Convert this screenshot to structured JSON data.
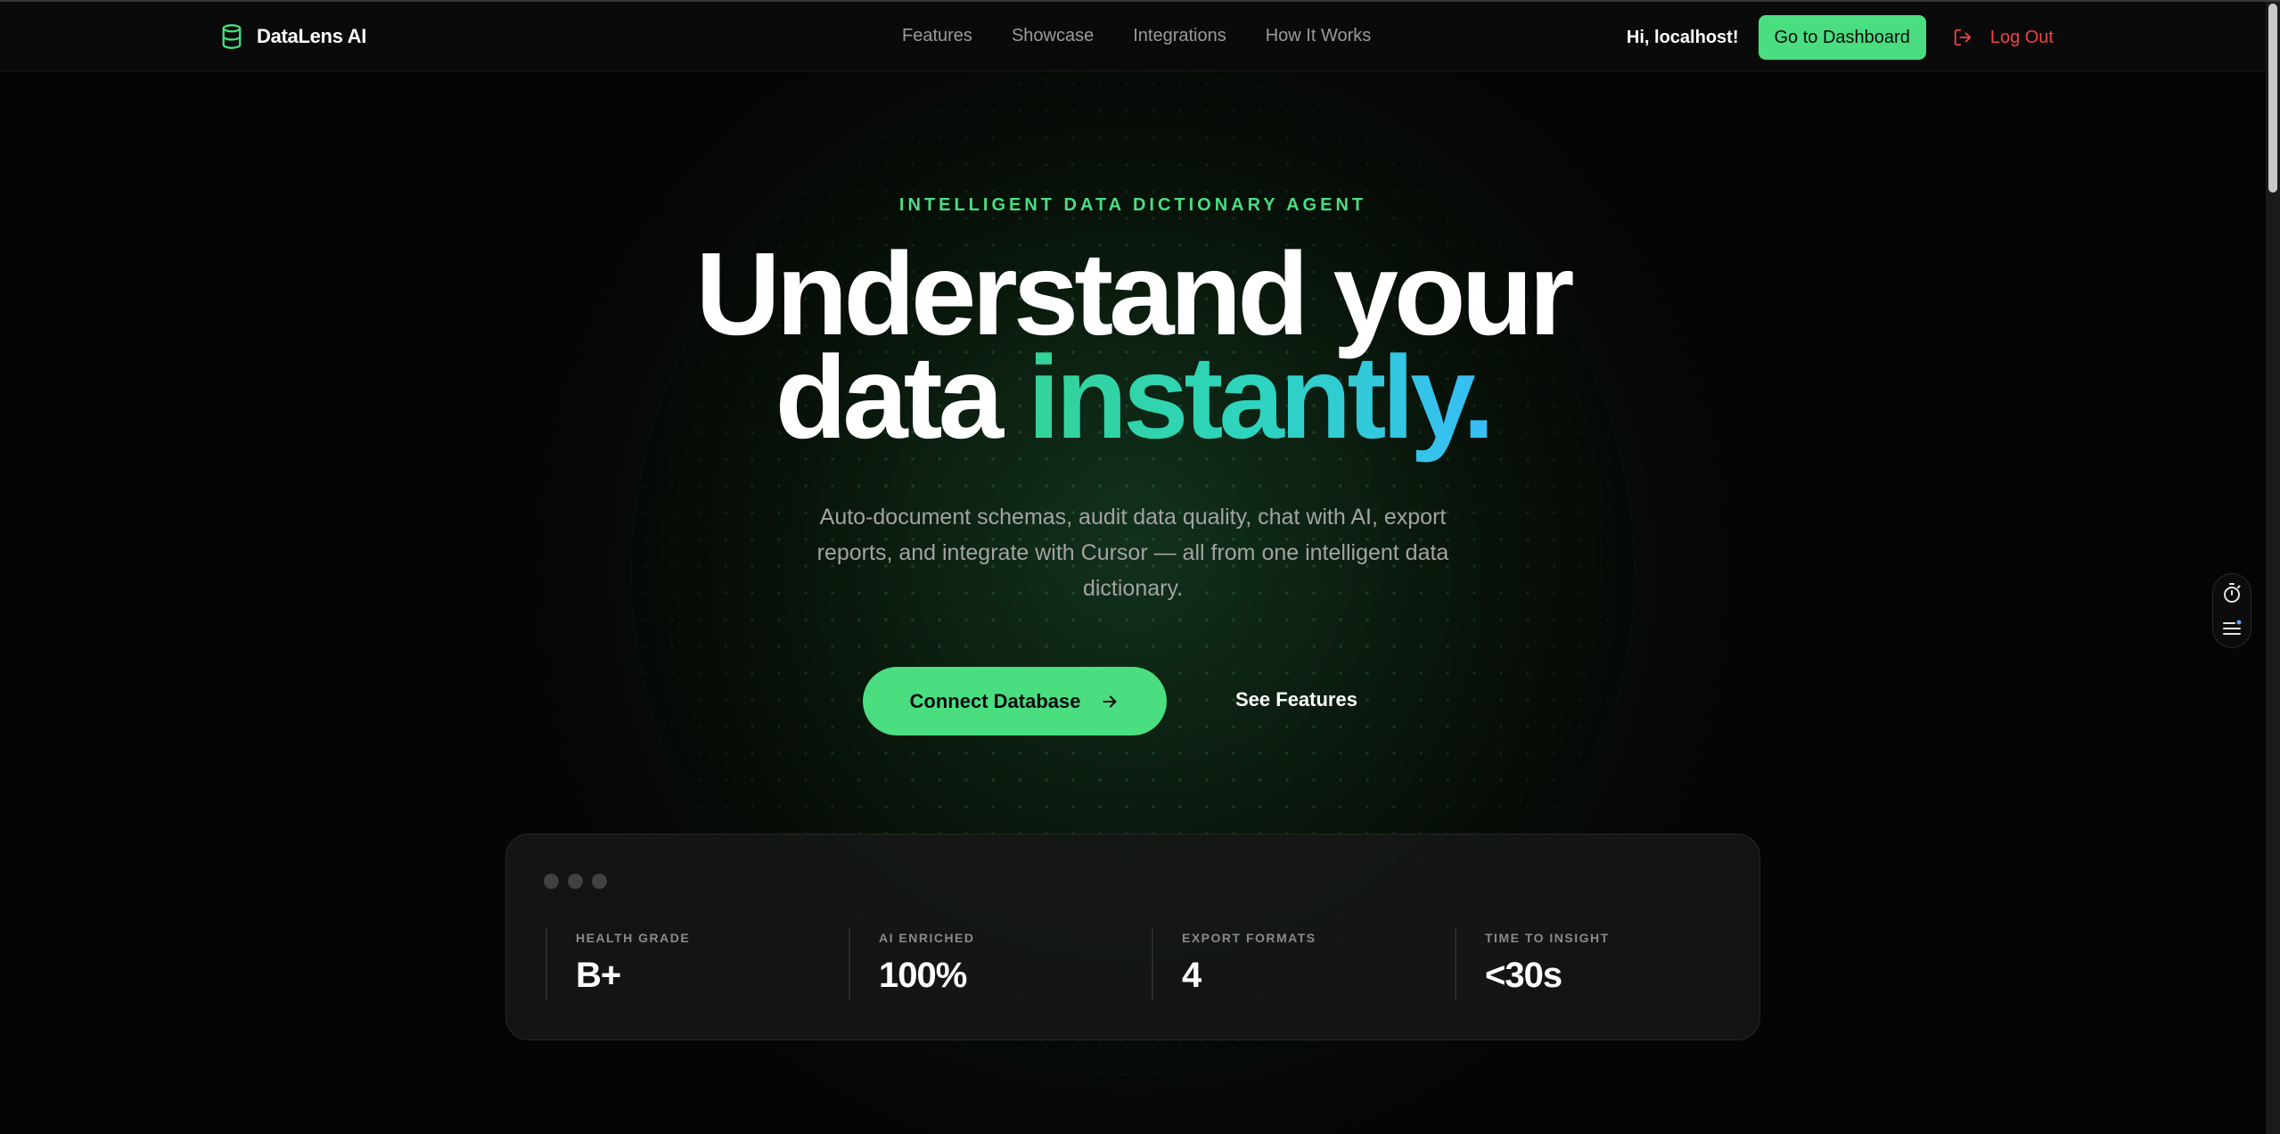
{
  "nav": {
    "brand": "DataLens AI",
    "brand_icon": "database-icon",
    "links": [
      "Features",
      "Showcase",
      "Integrations",
      "How It Works"
    ],
    "greeting": "Hi, localhost!",
    "dashboard_label": "Go to Dashboard",
    "logout_label": "Log Out",
    "logout_icon": "log-out-icon"
  },
  "hero": {
    "eyebrow": "INTELLIGENT DATA DICTIONARY AGENT",
    "headline_line1": "Understand your",
    "headline_word": "data",
    "headline_accent": "instantly.",
    "subtitle": "Auto-document schemas, audit data quality, chat with AI, export reports, and integrate with Cursor — all from one intelligent data dictionary.",
    "cta_primary": "Connect Database",
    "cta_secondary": "See Features"
  },
  "stats": [
    {
      "label": "HEALTH GRADE",
      "value": "B+"
    },
    {
      "label": "AI ENRICHED",
      "value": "100%"
    },
    {
      "label": "EXPORT FORMATS",
      "value": "4"
    },
    {
      "label": "TIME TO INSIGHT",
      "value": "<30s"
    }
  ],
  "widget": {
    "icons": [
      "timer-icon",
      "list-icon"
    ]
  },
  "colors": {
    "accent": "#4ade80",
    "danger": "#ef4444",
    "gradient_start": "#34d399",
    "gradient_end": "#38bdf8",
    "background": "#050505"
  }
}
